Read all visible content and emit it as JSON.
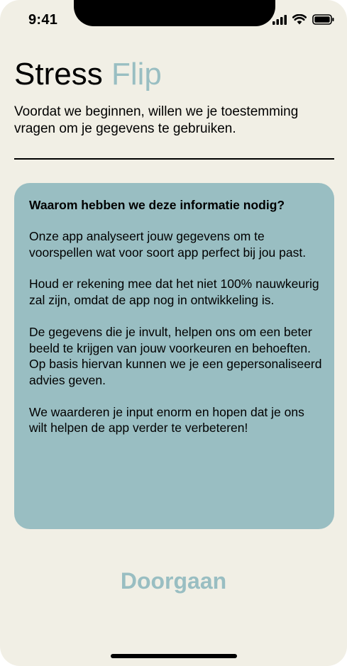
{
  "status_bar": {
    "time": "9:41",
    "icons": [
      "signal-icon",
      "wifi-icon",
      "battery-icon"
    ]
  },
  "header": {
    "title_main": "Stress",
    "title_accent": "Flip",
    "intro": "Voordat we beginnen, willen we je toestemming vragen om je gegevens te gebruiken."
  },
  "info_card": {
    "heading": "Waarom hebben we deze informatie nodig?",
    "paragraphs": [
      "Onze app analyseert jouw gegevens om te voorspellen wat voor soort app perfect bij jou past.",
      "Houd er rekening mee dat het niet 100% nauwkeurig zal zijn, omdat de app nog in ontwikkeling is.",
      "De gegevens die je invult, helpen ons om een beter beeld te krijgen van jouw voorkeuren en behoeften. Op basis hiervan kunnen we je een gepersonaliseerd advies geven.",
      "We waarderen je input enorm en hopen dat je ons wilt helpen de app verder te verbeteren!"
    ]
  },
  "actions": {
    "continue_label": "Doorgaan"
  },
  "colors": {
    "background": "#f1efe5",
    "accent": "#99bec2",
    "text": "#000000"
  }
}
